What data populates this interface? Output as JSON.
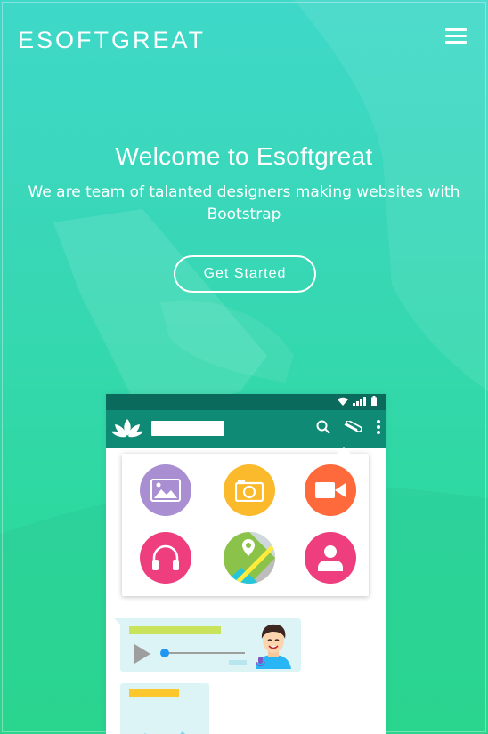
{
  "header": {
    "logo": "ESOFTGREAT",
    "menu_icon": "hamburger-menu-icon"
  },
  "hero": {
    "title": "Welcome to Esoftgreat",
    "subtitle": "We are team of talanted designers making websites with Bootstrap",
    "cta_label": "Get Started"
  },
  "colors": {
    "gradient_top": "#3fd8c9",
    "gradient_bottom": "#2cdc93",
    "status_bar": "#0a6a5c",
    "app_bar": "#0f8a74"
  },
  "phone": {
    "status_icons": [
      "wifi-icon",
      "signal-icon",
      "battery-icon"
    ],
    "app_logo_icon": "lotus-icon",
    "actions": [
      "search-icon",
      "paperclip-icon",
      "more-vert-icon"
    ],
    "attach_items": [
      {
        "icon": "gallery-icon",
        "color": "#a98fd2"
      },
      {
        "icon": "camera-icon",
        "color": "#fbba2c"
      },
      {
        "icon": "video-icon",
        "color": "#ff6a3d"
      },
      {
        "icon": "headphones-icon",
        "color": "#ee3e7d"
      },
      {
        "icon": "location-icon",
        "color": "#8bc34a"
      },
      {
        "icon": "contact-icon",
        "color": "#ee3e7d"
      }
    ]
  }
}
